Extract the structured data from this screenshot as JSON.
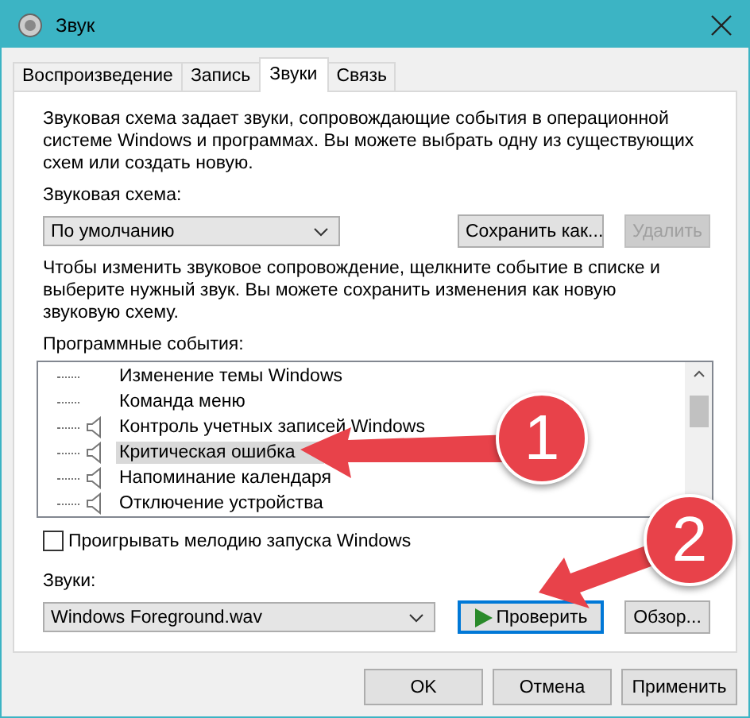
{
  "window": {
    "title": "Звук"
  },
  "tabs": [
    {
      "label": "Воспроизведение",
      "selected": false
    },
    {
      "label": "Запись",
      "selected": false
    },
    {
      "label": "Звуки",
      "selected": true
    },
    {
      "label": "Связь",
      "selected": false
    }
  ],
  "intro": "Звуковая схема задает звуки, сопровождающие события в операционной системе Windows и программах. Вы можете выбрать одну из существующих схем или создать новую.",
  "scheme": {
    "label": "Звуковая схема:",
    "value": "По умолчанию",
    "buttons": [
      {
        "label": "Сохранить как...",
        "disabled": false
      },
      {
        "label": "Удалить",
        "disabled": true
      }
    ]
  },
  "hint": "Чтобы изменить звуковое сопровождение, щелкните событие в списке и выберите нужный звук. Вы можете сохранить изменения как новую звуковую схему.",
  "events": {
    "label": "Программные события:",
    "items": [
      {
        "label": "Изменение темы Windows",
        "has_sound": false,
        "selected": false
      },
      {
        "label": "Команда меню",
        "has_sound": false,
        "selected": false
      },
      {
        "label": "Контроль учетных записей Windows",
        "has_sound": true,
        "selected": false
      },
      {
        "label": "Критическая ошибка",
        "has_sound": true,
        "selected": true
      },
      {
        "label": "Напоминание календаря",
        "has_sound": true,
        "selected": false
      },
      {
        "label": "Отключение устройства",
        "has_sound": true,
        "selected": false
      }
    ]
  },
  "startup": {
    "label": "Проигрывать мелодию запуска Windows",
    "checked": false
  },
  "sounds": {
    "label": "Звуки:",
    "value": "Windows Foreground.wav",
    "test_button": "Проверить",
    "browse_button": "Обзор..."
  },
  "buttons": [
    "OK",
    "Отмена",
    "Применить"
  ],
  "annotations": [
    {
      "number": "1"
    },
    {
      "number": "2"
    }
  ]
}
